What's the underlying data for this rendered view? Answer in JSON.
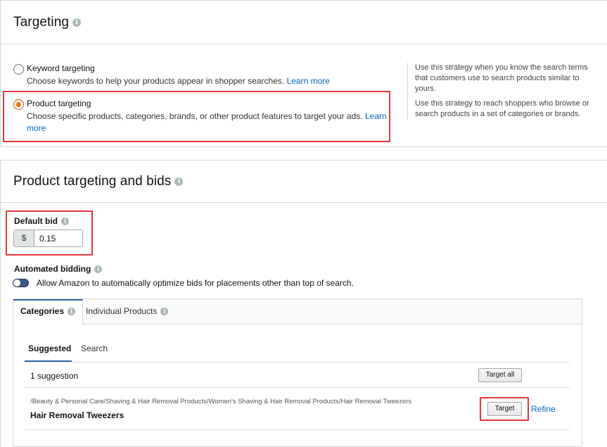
{
  "targeting": {
    "title": "Targeting",
    "options": [
      {
        "label": "Keyword targeting",
        "description": "Choose keywords to help your products appear in shopper searches.",
        "link": "Learn more",
        "selected": false
      },
      {
        "label": "Product targeting",
        "description": "Choose specific products, categories, brands, or other product features to target your ads.",
        "link_part1": "Learn",
        "link_part2": "more",
        "selected": true
      }
    ],
    "help": [
      "Use this strategy when you know the search terms that customers use to search products similar to yours.",
      "Use this strategy to reach shoppers who browse or search products in a set of categories or brands."
    ]
  },
  "product_targeting": {
    "title": "Product targeting and bids",
    "default_bid": {
      "label": "Default bid",
      "currency": "$",
      "value": "0.15"
    },
    "automated_bidding": {
      "label": "Automated bidding",
      "toggle_text": "Allow Amazon to automatically optimize bids for placements other than top of search.",
      "enabled": true
    },
    "tabs": [
      {
        "label": "Categories",
        "active": true
      },
      {
        "label": "Individual Products",
        "active": false
      }
    ],
    "subtabs": [
      {
        "label": "Suggested",
        "active": true
      },
      {
        "label": "Search",
        "active": false
      }
    ],
    "suggestion_count": "1 suggestion",
    "target_all_label": "Target all",
    "suggestions": [
      {
        "path": "/Beauty & Personal Care/Shaving & Hair Removal Products/Women's Shaving & Hair Removal Products/Hair Removal Tweezers",
        "name": "Hair Removal Tweezers",
        "target_label": "Target",
        "refine_label": "Refine"
      }
    ]
  },
  "colors": {
    "link": "#0066c0",
    "highlight": "#e2373f",
    "radio_selected": "#e77600",
    "tab_accent": "#2d6aa5",
    "toggle_on": "#3b5a86"
  }
}
